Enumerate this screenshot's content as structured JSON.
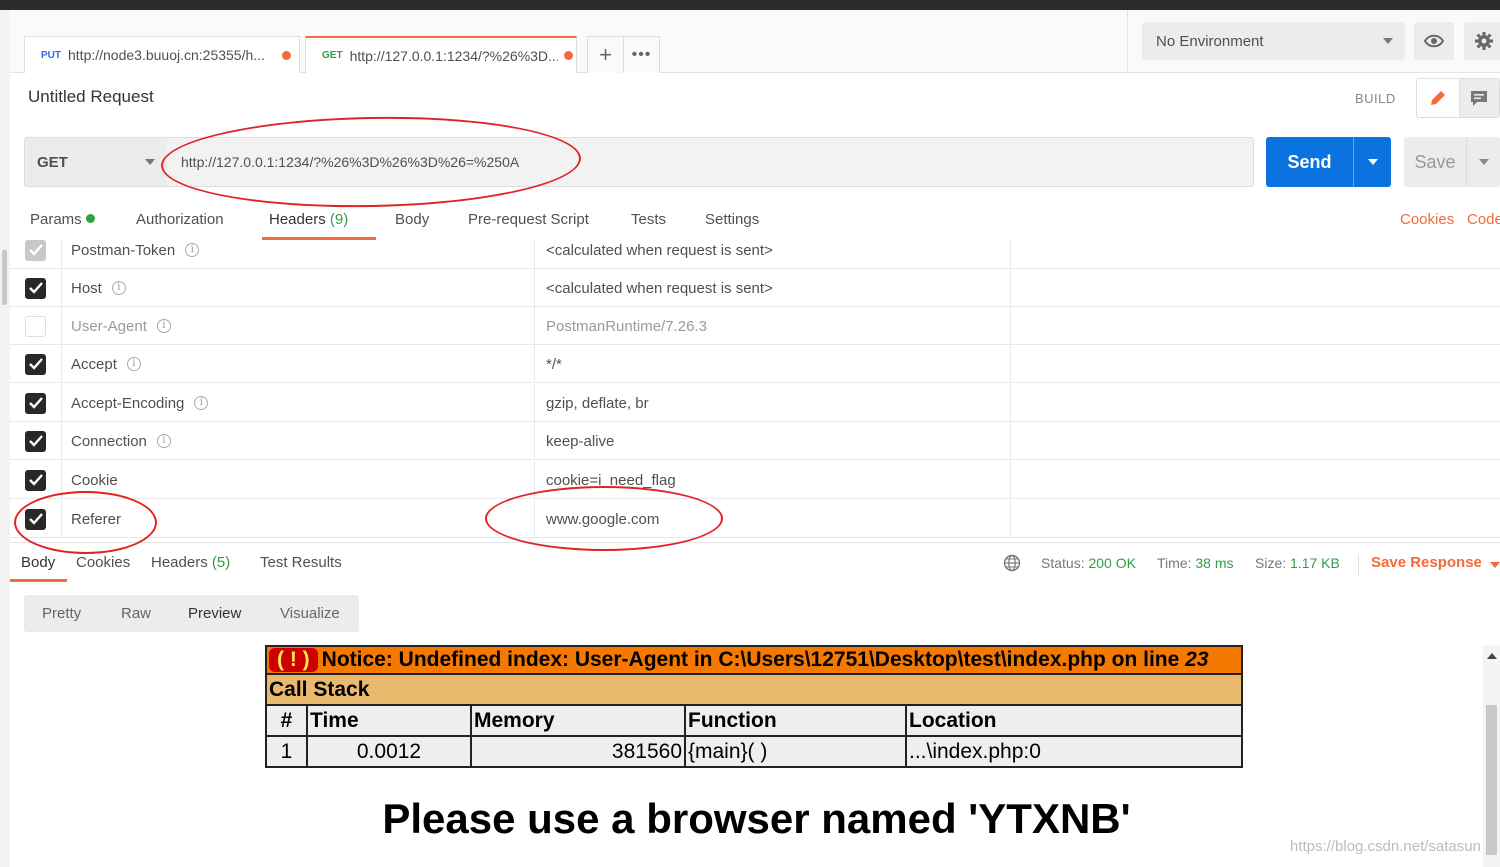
{
  "tabs": [
    {
      "method": "PUT",
      "url": "http://node3.buuoj.cn:25355/h..."
    },
    {
      "method": "GET",
      "url": "http://127.0.0.1:1234/?%26%3D..."
    }
  ],
  "tab_actions": {
    "add": "+",
    "more": "•••"
  },
  "environment": {
    "selected": "No Environment"
  },
  "request": {
    "title": "Untitled Request",
    "mode_label": "BUILD",
    "method": "GET",
    "url": "http://127.0.0.1:1234/?%26%3D%26%3D%26=%250A",
    "send_label": "Send",
    "save_label": "Save"
  },
  "request_tabs": {
    "params": "Params",
    "authorization": "Authorization",
    "headers": "Headers",
    "headers_count": "(9)",
    "body": "Body",
    "prerequest": "Pre-request Script",
    "tests": "Tests",
    "settings": "Settings",
    "cookies": "Cookies",
    "code": "Code"
  },
  "headers": [
    {
      "key": "Postman-Token",
      "value": "<calculated when request is sent>",
      "state": "light",
      "info": true
    },
    {
      "key": "Host",
      "value": "<calculated when request is sent>",
      "state": "on",
      "info": true
    },
    {
      "key": "User-Agent",
      "value": "PostmanRuntime/7.26.3",
      "state": "off",
      "info": true
    },
    {
      "key": "Accept",
      "value": "*/*",
      "state": "on",
      "info": true
    },
    {
      "key": "Accept-Encoding",
      "value": "gzip, deflate, br",
      "state": "on",
      "info": true
    },
    {
      "key": "Connection",
      "value": "keep-alive",
      "state": "on",
      "info": true
    },
    {
      "key": "Cookie",
      "value": "cookie=i_need_flag",
      "state": "on",
      "info": false
    },
    {
      "key": "Referer",
      "value": "www.google.com",
      "state": "on",
      "info": false
    }
  ],
  "response": {
    "tabs": {
      "body": "Body",
      "cookies": "Cookies",
      "headers": "Headers",
      "headers_count": "(5)",
      "test_results": "Test Results"
    },
    "status_label": "Status:",
    "status_value": "200 OK",
    "time_label": "Time:",
    "time_value": "38 ms",
    "size_label": "Size:",
    "size_value": "1.17 KB",
    "save_response": "Save Response",
    "view_tabs": {
      "pretty": "Pretty",
      "raw": "Raw",
      "preview": "Preview",
      "visualize": "Visualize"
    }
  },
  "preview": {
    "notice_bang": "( ! )",
    "notice_text": "Notice: Undefined index: User-Agent in C:\\Users\\12751\\Desktop\\test\\index.php on line ",
    "notice_line": "23",
    "callstack_title": "Call Stack",
    "columns": [
      "#",
      "Time",
      "Memory",
      "Function",
      "Location"
    ],
    "rows": [
      {
        "num": "1",
        "time": "0.0012",
        "memory": "381560",
        "function": "{main}( )",
        "location": "...\\index.php:0"
      }
    ],
    "message": "Please use a browser named 'YTXNB'"
  },
  "watermark": "https://blog.csdn.net/satasun",
  "colors": {
    "accent": "#f26b3a",
    "send": "#0a73e0",
    "ok": "#2f9e44",
    "annotation": "#e02424"
  }
}
